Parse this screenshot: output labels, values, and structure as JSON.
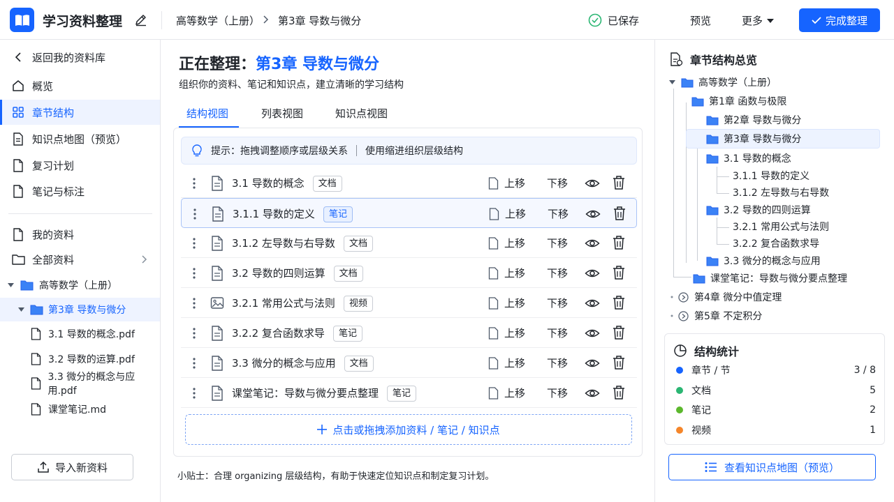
{
  "header": {
    "app_title": "学习资料整理",
    "breadcrumb": [
      "高等数学（上册）",
      "第3章 导数与微分"
    ],
    "saved": "已保存",
    "preview": "预览",
    "more": "更多",
    "done": "完成整理"
  },
  "sidebar": {
    "back": "返回我的资料库",
    "nav": [
      "概览",
      "章节结构",
      "知识点地图（预览）",
      "复习计划",
      "笔记与标注"
    ],
    "my_files": "我的资料",
    "all_files": "全部资料",
    "tree_book": "高等数学（上册）",
    "tree_chapter": "第3章 导数与微分",
    "files": [
      "3.1 导数的概念.pdf",
      "3.2 导数的运算.pdf",
      "3.3 微分的概念与应用.pdf",
      "课堂笔记.md"
    ],
    "import": "导入新资料"
  },
  "main": {
    "title_prefix": "正在整理：",
    "title_highlight": "第3章 导数与微分",
    "subtitle": "组织你的资料、笔记和知识点，建立清晰的学习结构",
    "tabs": [
      "结构视图",
      "列表视图",
      "知识点视图"
    ],
    "tip_a": "提示：拖拽调整顺序或层级关系",
    "tip_b": "使用缩进组织层级结构",
    "up_label": "上移",
    "down_label": "下移",
    "rows": [
      {
        "title": "3.1 导数的概念",
        "tag": "文档"
      },
      {
        "title": "3.1.1 导数的定义",
        "tag": "笔记"
      },
      {
        "title": "3.1.2 左导数与右导数",
        "tag": "文档"
      },
      {
        "title": "3.2 导数的四则运算",
        "tag": "文档"
      },
      {
        "title": "3.2.1 常用公式与法则",
        "tag": "视频"
      },
      {
        "title": "3.2.2 复合函数求导",
        "tag": "笔记"
      },
      {
        "title": "3.3 微分的概念与应用",
        "tag": "文档"
      },
      {
        "title": "课堂笔记：导数与微分要点整理",
        "tag": "笔记"
      }
    ],
    "add": "点击或拖拽添加资料 / 笔记 / 知识点",
    "footer_tip": "小贴士：合理 organizing 层级结构，有助于快速定位知识点和制定复习计划。"
  },
  "outline": {
    "title": "章节结构总览",
    "nodes": [
      "高等数学（上册）",
      "第1章 函数与极限",
      "第2章 导数与微分",
      "第3章 导数与微分",
      "3.1 导数的概念",
      "3.1.1 导数的定义",
      "3.1.2 左导数与右导数",
      "3.2 导数的四则运算",
      "3.2.1 常用公式与法则",
      "3.2.2 复合函数求导",
      "3.3 微分的概念与应用",
      "课堂笔记：导数与微分要点整理",
      "第4章 微分中值定理",
      "第5章 不定积分"
    ]
  },
  "stats": {
    "title": "结构统计",
    "rows": [
      {
        "label": "章节 / 节",
        "value": "3 / 8",
        "color": "#1664ff"
      },
      {
        "label": "文档",
        "value": "5",
        "color": "#2bb673"
      },
      {
        "label": "笔记",
        "value": "2",
        "color": "#5cb82d"
      },
      {
        "label": "视频",
        "value": "1",
        "color": "#f5862a"
      }
    ]
  },
  "map_button": "查看知识点地图（预览）",
  "colors": {
    "accent": "#1664ff",
    "selected_bg": "#eef3ff",
    "folder": "#3b82f6"
  }
}
